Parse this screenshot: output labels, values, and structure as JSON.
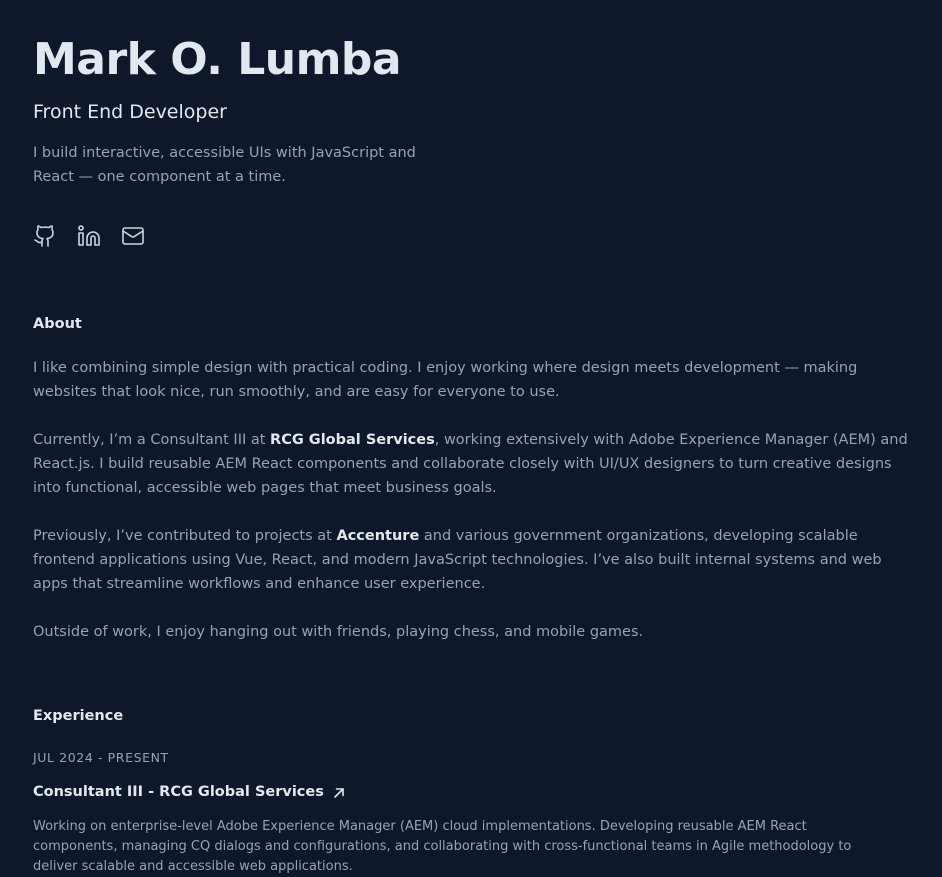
{
  "header": {
    "name": "Mark O. Lumba",
    "role": "Front End Developer",
    "tagline": "I build interactive, accessible UIs with JavaScript and React — one component at a time."
  },
  "socials": [
    {
      "icon": "github-icon",
      "label": "GitHub"
    },
    {
      "icon": "linkedin-icon",
      "label": "LinkedIn"
    },
    {
      "icon": "mail-icon",
      "label": "Email"
    }
  ],
  "about": {
    "title": "About",
    "p1": "I like combining simple design with practical coding. I enjoy working where design meets development — making websites that look nice, run smoothly, and are easy for everyone to use.",
    "p2_before": "Currently, I’m a Consultant III at ",
    "p2_strong": "RCG Global Services",
    "p2_after": ", working extensively with Adobe Experience Manager (AEM) and React.js. I build reusable AEM React components and collaborate closely with UI/UX designers to turn creative designs into functional, accessible web pages that meet business goals.",
    "p3_before": "Previously, I’ve contributed to projects at ",
    "p3_strong": "Accenture",
    "p3_after": " and various government organizations, developing scalable frontend applications using Vue, React, and modern JavaScript technologies. I’ve also built internal systems and web apps that streamline workflows and enhance user experience.",
    "p4": "Outside of work, I enjoy hanging out with friends, playing chess, and mobile games."
  },
  "experience": {
    "title": "Experience",
    "items": [
      {
        "date": "JUL 2024 - PRESENT",
        "title": "Consultant III - RCG Global Services",
        "description": "Working on enterprise-level Adobe Experience Manager (AEM) cloud implementations. Developing reusable AEM React components, managing CQ dialogs and configurations, and collaborating with cross-functional teams in Agile methodology to deliver scalable and accessible web applications."
      }
    ]
  },
  "colors": {
    "background": "#0f172a",
    "heading": "#e2e8f0",
    "body": "#94a3b8"
  }
}
